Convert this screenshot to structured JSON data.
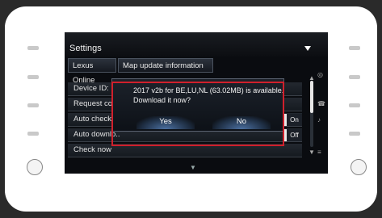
{
  "screen": {
    "title": "Settings",
    "tabs": [
      {
        "label": "Lexus Online"
      },
      {
        "label": "Map update information"
      }
    ],
    "rows": [
      {
        "label": "Device ID:"
      },
      {
        "label": "Request code"
      },
      {
        "label": "Auto check",
        "toggle": "On"
      },
      {
        "label": "Auto downlo..",
        "toggle": "Off"
      },
      {
        "label": "Check now"
      }
    ]
  },
  "dialog": {
    "message_line1": "2017 v2b for BE,LU,NL (63.02MB) is available.",
    "message_line2": "Download it now?",
    "yes_label": "Yes",
    "no_label": "No"
  },
  "colors": {
    "highlight": "#d0202c",
    "bezel": "#ffffff",
    "screen_bg": "#0a0c10",
    "button_glow": "#4b6fa0"
  }
}
